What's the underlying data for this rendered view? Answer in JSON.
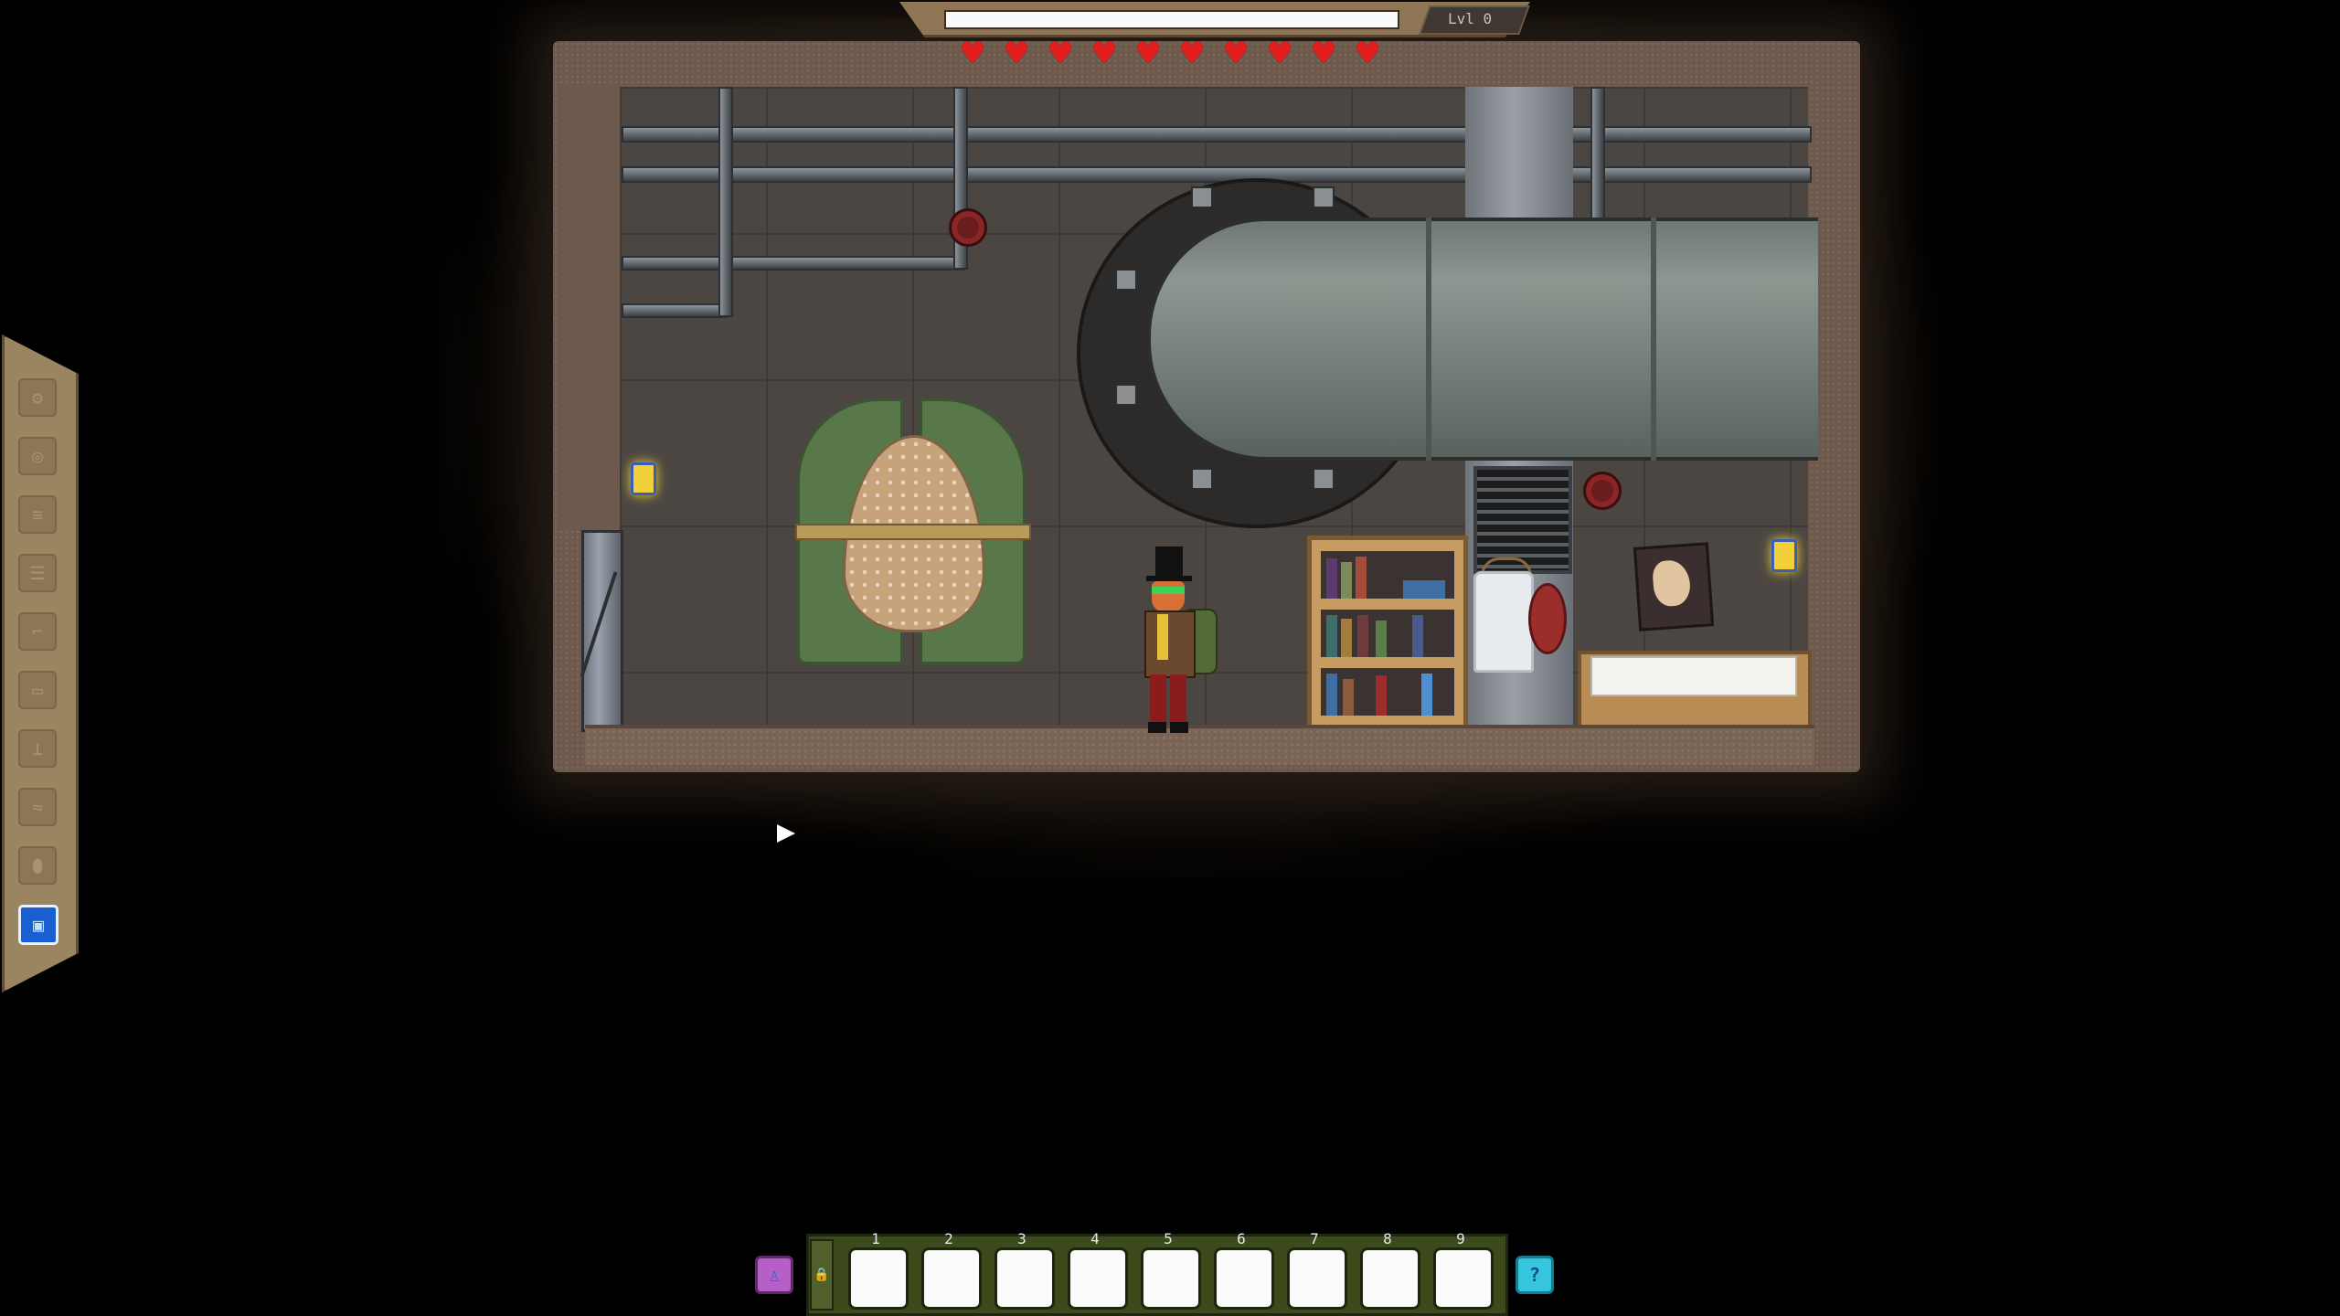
{
  "hud": {
    "level_label": "Lvl 0",
    "xp_fraction": 1.0,
    "health": {
      "current": 10,
      "max": 10
    },
    "heart_icon": "♥"
  },
  "toolbar": {
    "tools": [
      {
        "name": "craft-icon",
        "glyph": "⚙",
        "active": false
      },
      {
        "name": "gear-icon",
        "glyph": "◎",
        "active": false
      },
      {
        "name": "build-icon",
        "glyph": "≡",
        "active": false
      },
      {
        "name": "machine-icon",
        "glyph": "☰",
        "active": false
      },
      {
        "name": "pipe-icon",
        "glyph": "⌐",
        "active": false
      },
      {
        "name": "engine-icon",
        "glyph": "▭",
        "active": false
      },
      {
        "name": "dig-icon",
        "glyph": "⊥",
        "active": false
      },
      {
        "name": "wire-icon",
        "glyph": "≈",
        "active": false
      },
      {
        "name": "shield-icon",
        "glyph": "⬮",
        "active": false
      },
      {
        "name": "blueprint-icon",
        "glyph": "▣",
        "active": true
      }
    ]
  },
  "hotbar": {
    "slots": [
      {
        "number": "1"
      },
      {
        "number": "2"
      },
      {
        "number": "3"
      },
      {
        "number": "4"
      },
      {
        "number": "5"
      },
      {
        "number": "6"
      },
      {
        "number": "7"
      },
      {
        "number": "8"
      },
      {
        "number": "9"
      }
    ],
    "lock_glyph": "🔒",
    "character_button_glyph": "♙",
    "help_button_glyph": "?"
  },
  "colors": {
    "heart": "#e31d1d",
    "active_tool": "#1a5fd1",
    "hotbar_frame": "#3d4a1c",
    "help_button": "#37c5de",
    "character_button": "#b65fc7"
  }
}
